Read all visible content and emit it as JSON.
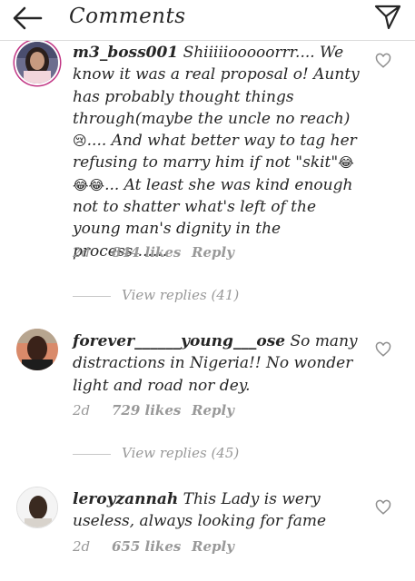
{
  "header": {
    "title": "Comments",
    "back_icon": "arrow-left-icon",
    "send_icon": "paper-plane-icon"
  },
  "comments": [
    {
      "username": "m3_boss001",
      "text_parts": [
        " Shiiiiiooooorrr.... We know it was a real proposal o! Aunty has probably thought things through(maybe the uncle no reach)",
        "😢",
        ".... And what better way to tag her refusing to marry him if not \"skit\"",
        "😂😂😂",
        "... At least she was kind enough not to shatter what's left of the young man's dignity in the process......."
      ],
      "time": "2d",
      "likes": "844 likes",
      "reply": "Reply",
      "view_replies": "View replies (41)"
    },
    {
      "username": "forever______young___ose",
      "text": " So many distractions in Nigeria!! No wonder light and road nor dey.",
      "time": "2d",
      "likes": "729 likes",
      "reply": "Reply",
      "view_replies": "View replies (45)"
    },
    {
      "username": "leroyzannah",
      "text": " This Lady is wery useless, always looking for fame",
      "time": "2d",
      "likes": "655 likes",
      "reply": "Reply"
    }
  ],
  "colors": {
    "text": "#262626",
    "meta": "#999999",
    "divider": "#dbdbdb"
  }
}
